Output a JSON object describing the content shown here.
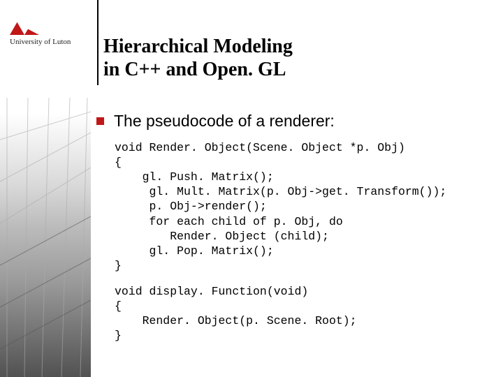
{
  "logo": {
    "text": "University of Luton"
  },
  "title": {
    "line1": "Hierarchical Modeling",
    "line2": "in C++ and Open. GL"
  },
  "body": {
    "bullet1": "The pseudocode of a renderer:",
    "code1": "void Render. Object(Scene. Object *p. Obj)\n{\n    gl. Push. Matrix();\n     gl. Mult. Matrix(p. Obj->get. Transform());\n     p. Obj->render();\n     for each child of p. Obj, do\n        Render. Object (child);\n     gl. Pop. Matrix();\n}",
    "code2": "void display. Function(void)\n{\n    Render. Object(p. Scene. Root);\n}"
  }
}
